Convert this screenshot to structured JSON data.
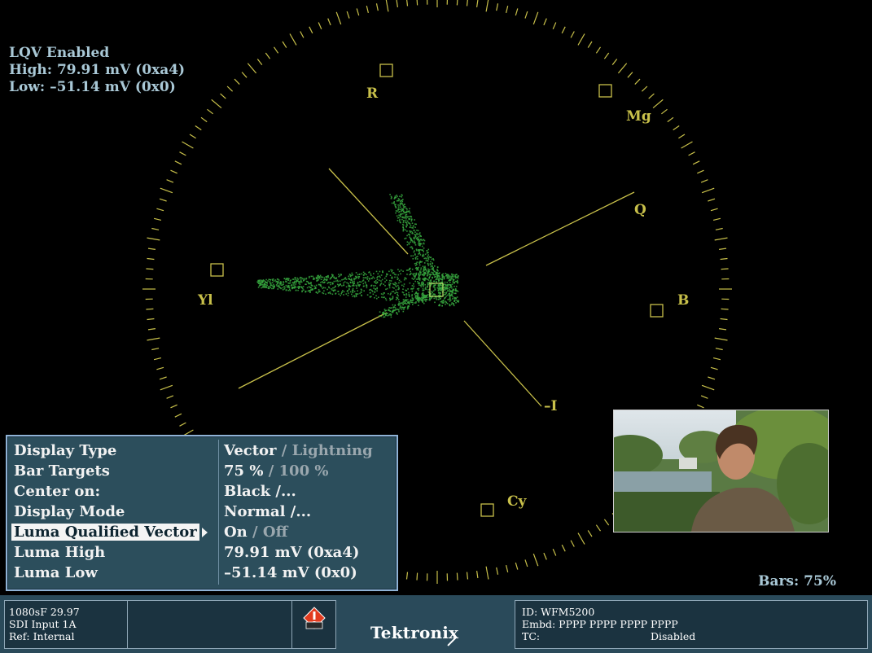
{
  "status": {
    "lqv_label": "LQV Enabled",
    "high": "High: 79.91 mV (0xa4)",
    "low": "Low: –51.14 mV (0x0)"
  },
  "scope": {
    "labels": {
      "r": "R",
      "mg": "Mg",
      "q": "Q",
      "b": "B",
      "yl": "Yl",
      "neg_i": "–I",
      "cy": "Cy"
    },
    "colors": {
      "graticule": "#c8c04a",
      "trace": "#37a83f"
    }
  },
  "bars_text": "Bars: 75%",
  "menu": {
    "rows": [
      {
        "label": "Display Type",
        "value_active": "Vector",
        "value_sep": " / ",
        "value_inactive": "Lightning"
      },
      {
        "label": "Bar Targets",
        "value_active": "75 %",
        "value_sep": " / ",
        "value_inactive": "100 %"
      },
      {
        "label": "Center on:",
        "value_active": "Black /...",
        "value_sep": "",
        "value_inactive": ""
      },
      {
        "label": "Display Mode",
        "value_active": "Normal /...",
        "value_sep": "",
        "value_inactive": ""
      },
      {
        "label": "Luma Qualified Vector",
        "value_active": "On",
        "value_sep": " / ",
        "value_inactive": "Off"
      },
      {
        "label": "Luma High",
        "value_active": "79.91 mV (0xa4)",
        "value_sep": "",
        "value_inactive": ""
      },
      {
        "label": "Luma Low",
        "value_active": "–51.14 mV (0x0)",
        "value_sep": "",
        "value_inactive": ""
      }
    ],
    "selected_index": 4
  },
  "footer": {
    "format": "1080sF 29.97",
    "input": "SDI Input 1A",
    "ref": "Ref: Internal",
    "brand": "Tektronix",
    "id": "ID: WFM5200",
    "embd": "Embd: PPPP PPPP PPPP PPPP",
    "tc_label": "TC:",
    "tc_value": "Disabled",
    "warning_icon": "alarm-warning-icon"
  }
}
